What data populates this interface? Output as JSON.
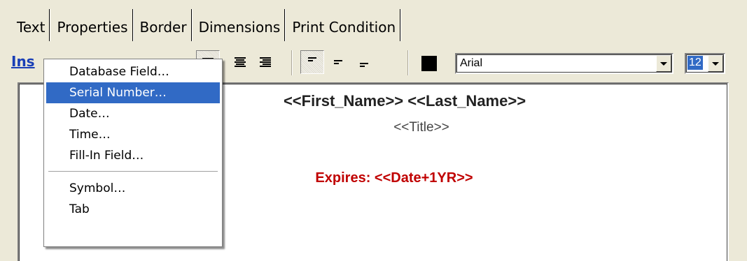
{
  "tabs": [
    {
      "label": "Text",
      "active": true
    },
    {
      "label": "Properties",
      "active": false
    },
    {
      "label": "Border",
      "active": false
    },
    {
      "label": "Dimensions",
      "active": false
    },
    {
      "label": "Print Condition",
      "active": false
    }
  ],
  "toolbar": {
    "insert_label": "Ins",
    "buttons": [
      "align-center-icon",
      "align-right-icon",
      "valign-top-icon",
      "valign-middle-icon",
      "valign-bottom-icon",
      "text-color-icon"
    ],
    "text_color": "#000000",
    "font_value": "Arial",
    "size_value": "12"
  },
  "insert_menu": {
    "items": [
      {
        "label": "Database Field…",
        "highlighted": false
      },
      {
        "label": "Serial Number…",
        "highlighted": true
      },
      {
        "label": "Date…",
        "highlighted": false
      },
      {
        "label": "Time…",
        "highlighted": false
      },
      {
        "label": "Fill-In Field…",
        "highlighted": false
      },
      {
        "label": "Symbol…",
        "highlighted": false
      },
      {
        "label": "Tab",
        "highlighted": false
      }
    ]
  },
  "editor": {
    "line1": "<<First_Name>> <<Last_Name>>",
    "line2": "<<Title>>",
    "line3": "Expires: <<Date+1YR>>",
    "expires_color": "#C00000"
  },
  "colors": {
    "window_bg": "#ECE9D8",
    "highlight": "#316AC5",
    "insert_link": "#1A3FB6"
  }
}
